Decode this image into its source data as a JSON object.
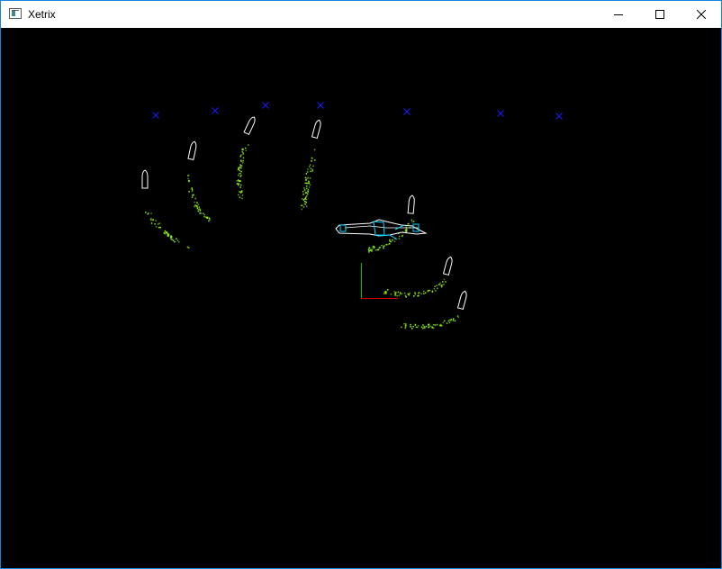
{
  "window": {
    "title": "Xetrix",
    "controls": {
      "minimize_icon": "minimize-icon",
      "maximize_icon": "maximize-icon",
      "close_icon": "close-icon"
    }
  },
  "colors": {
    "window_border": "#1883d7",
    "viewport_background": "#000000",
    "marker": "#1a1aff",
    "finger_trail": "#9aff1a",
    "pointer_outline": "#ffffff",
    "hand_wireframe": "#ffffff",
    "hand_wireframe_accent": "#00d8ff",
    "axis_y": "#00c000",
    "axis_x": "#d00000"
  },
  "scene": {
    "target_markers": 7,
    "finger_trails": 7,
    "pointer_icons": 7,
    "axis_gizmo": [
      "x-axis",
      "y-axis"
    ]
  }
}
